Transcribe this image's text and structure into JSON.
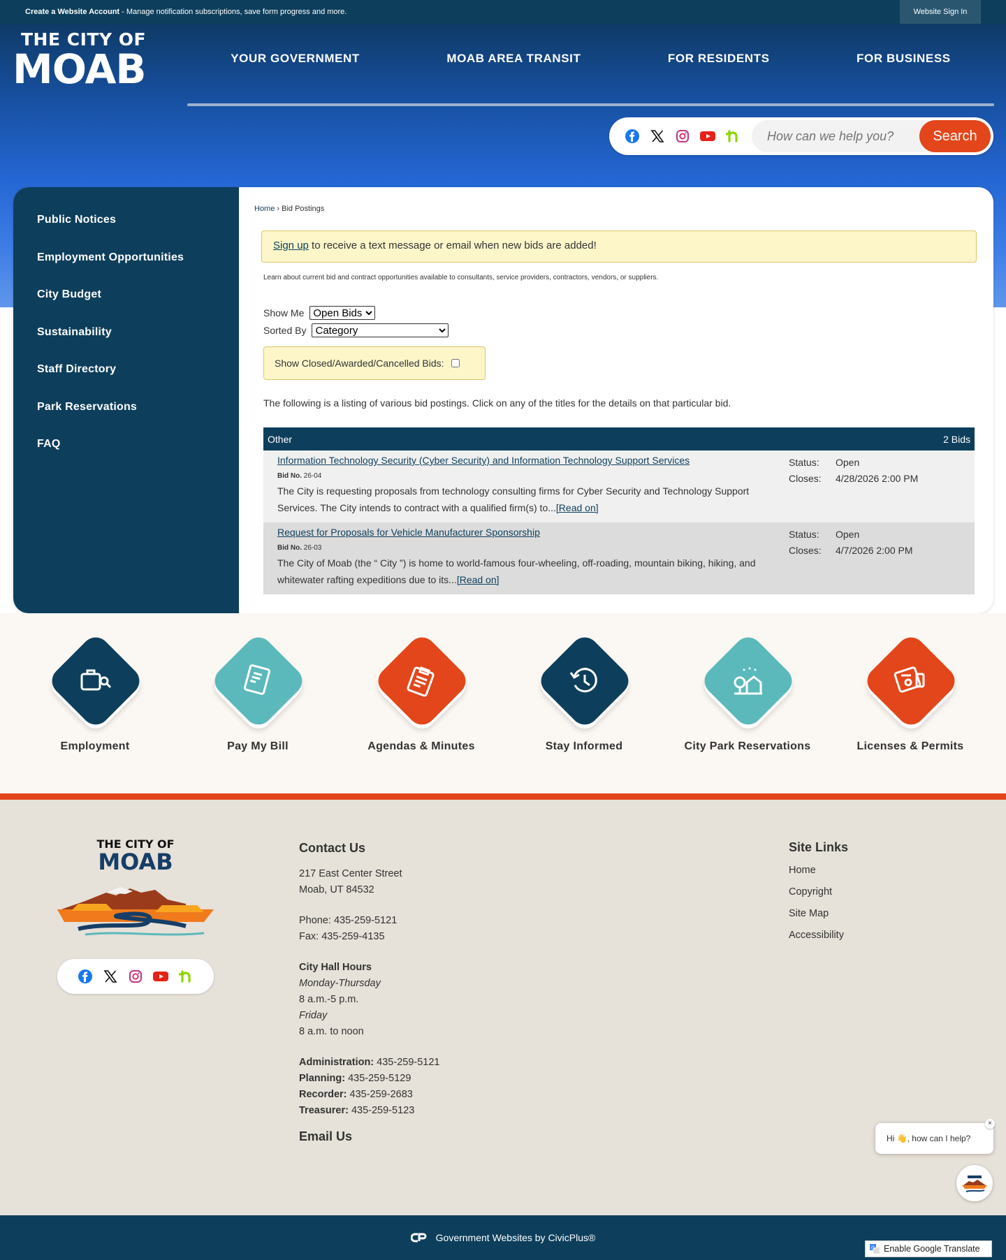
{
  "topbar": {
    "create_account": "Create a Website Account",
    "create_account_desc": " - Manage notification subscriptions, save form progress and more.",
    "sign_in": "Website Sign In"
  },
  "logo": {
    "line1": "THE CITY OF",
    "line2": "MOAB"
  },
  "nav": {
    "items": [
      "YOUR GOVERNMENT",
      "MOAB AREA TRANSIT",
      "FOR RESIDENTS",
      "FOR BUSINESS"
    ]
  },
  "social_icons": [
    "facebook-icon",
    "x-icon",
    "instagram-icon",
    "youtube-icon",
    "nextdoor-icon"
  ],
  "search": {
    "placeholder": "How can we help you?",
    "button": "Search"
  },
  "sidebar": {
    "items": [
      "Public Notices",
      "Employment Opportunities",
      "City Budget",
      "Sustainability",
      "Staff Directory",
      "Park Reservations",
      "FAQ"
    ]
  },
  "breadcrumb": {
    "home": "Home",
    "separator": " › ",
    "current": "Bid Postings"
  },
  "alert": {
    "link": "Sign up",
    "text": " to receive a text message or email when new bids are added!"
  },
  "intro": "Learn about current bid and contract opportunities available to consultants, service providers, contractors, vendors, or suppliers.",
  "filters": {
    "show_me_label": "Show Me",
    "show_me_value": "Open Bids",
    "sorted_by_label": "Sorted By",
    "sorted_by_value": "Category",
    "closed_label": "Show Closed/Awarded/Cancelled Bids:"
  },
  "listing_text": "The following is a listing of various bid postings. Click on any of the titles for the details on that particular bid.",
  "table": {
    "category": "Other",
    "count": "2 Bids",
    "status_label": "Status:",
    "closes_label": "Closes:",
    "bid_no_label": "Bid No.",
    "read_on": "[Read on]",
    "bids": [
      {
        "title": "Information Technology Security (Cyber Security) and Information Technology Support Services",
        "bid_no": "26-04",
        "description": "The City is requesting proposals from technology consulting firms for Cyber Security and Technology Support Services. The City intends to contract with a qualified firm(s) to...",
        "status": "Open",
        "closes": "4/28/2026 2:00 PM"
      },
      {
        "title": "Request for Proposals for Vehicle Manufacturer Sponsorship",
        "bid_no": "26-03",
        "description": "The City of Moab (the “ City ”) is home to world-famous four-wheeling, off-roading, mountain biking, hiking, and whitewater rafting expeditions due to its...",
        "status": "Open",
        "closes": "4/7/2026 2:00 PM"
      }
    ]
  },
  "quick_links": [
    {
      "label": "Employment",
      "color": "#0d3f5c",
      "icon": "briefcase-search-icon"
    },
    {
      "label": "Pay My Bill",
      "color": "#5bb9bc",
      "icon": "bill-icon"
    },
    {
      "label": "Agendas & Minutes",
      "color": "#e2461a",
      "icon": "clipboard-icon"
    },
    {
      "label": "Stay Informed",
      "color": "#0d3f5c",
      "icon": "history-icon"
    },
    {
      "label": "City Park Reservations",
      "color": "#5bb9bc",
      "icon": "park-icon"
    },
    {
      "label": "Licenses & Permits",
      "color": "#e2461a",
      "icon": "license-icon"
    }
  ],
  "footer": {
    "logo_line1": "THE CITY OF",
    "logo_line2": "MOAB",
    "contact_title": "Contact Us",
    "address1": "217 East Center Street",
    "address2": "Moab, UT 84532",
    "phone": "Phone: 435-259-5121",
    "fax": "Fax: 435-259-4135",
    "hours_title": "City Hall Hours",
    "hours_days1": "Monday-Thursday",
    "hours_time1": "8 a.m.-5 p.m.",
    "hours_days2": "Friday",
    "hours_time2": "8 a.m. to noon",
    "departments": [
      {
        "name": "Administration:",
        "phone": " 435-259-5121"
      },
      {
        "name": "Planning:",
        "phone": " 435-259-5129"
      },
      {
        "name": "Recorder:",
        "phone": " 435-259-2683"
      },
      {
        "name": "Treasurer:",
        "phone": " 435-259-5123"
      }
    ],
    "email_us": "Email Us",
    "site_links_title": "Site Links",
    "site_links": [
      "Home",
      "Copyright",
      "Site Map",
      "Accessibility"
    ]
  },
  "chat": {
    "greeting": "Hi 👋, how can I help?",
    "close": "×"
  },
  "bottom": {
    "text": "Government Websites by CivicPlus®",
    "translate": "Enable Google Translate"
  },
  "colors": {
    "navy": "#0d3f5c",
    "orange": "#e2461a",
    "teal": "#5bb9bc",
    "alert_bg": "#fcf6c9"
  }
}
